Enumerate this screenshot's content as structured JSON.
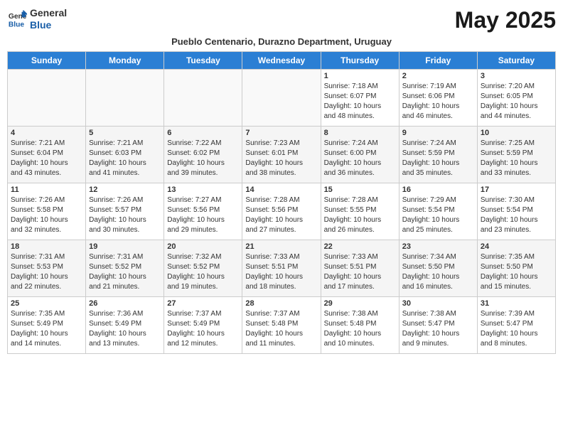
{
  "header": {
    "logo_general": "General",
    "logo_blue": "Blue",
    "month_title": "May 2025",
    "subtitle": "Pueblo Centenario, Durazno Department, Uruguay"
  },
  "days_of_week": [
    "Sunday",
    "Monday",
    "Tuesday",
    "Wednesday",
    "Thursday",
    "Friday",
    "Saturday"
  ],
  "weeks": [
    [
      {
        "day": "",
        "info": ""
      },
      {
        "day": "",
        "info": ""
      },
      {
        "day": "",
        "info": ""
      },
      {
        "day": "",
        "info": ""
      },
      {
        "day": "1",
        "info": "Sunrise: 7:18 AM\nSunset: 6:07 PM\nDaylight: 10 hours\nand 48 minutes."
      },
      {
        "day": "2",
        "info": "Sunrise: 7:19 AM\nSunset: 6:06 PM\nDaylight: 10 hours\nand 46 minutes."
      },
      {
        "day": "3",
        "info": "Sunrise: 7:20 AM\nSunset: 6:05 PM\nDaylight: 10 hours\nand 44 minutes."
      }
    ],
    [
      {
        "day": "4",
        "info": "Sunrise: 7:21 AM\nSunset: 6:04 PM\nDaylight: 10 hours\nand 43 minutes."
      },
      {
        "day": "5",
        "info": "Sunrise: 7:21 AM\nSunset: 6:03 PM\nDaylight: 10 hours\nand 41 minutes."
      },
      {
        "day": "6",
        "info": "Sunrise: 7:22 AM\nSunset: 6:02 PM\nDaylight: 10 hours\nand 39 minutes."
      },
      {
        "day": "7",
        "info": "Sunrise: 7:23 AM\nSunset: 6:01 PM\nDaylight: 10 hours\nand 38 minutes."
      },
      {
        "day": "8",
        "info": "Sunrise: 7:24 AM\nSunset: 6:00 PM\nDaylight: 10 hours\nand 36 minutes."
      },
      {
        "day": "9",
        "info": "Sunrise: 7:24 AM\nSunset: 5:59 PM\nDaylight: 10 hours\nand 35 minutes."
      },
      {
        "day": "10",
        "info": "Sunrise: 7:25 AM\nSunset: 5:59 PM\nDaylight: 10 hours\nand 33 minutes."
      }
    ],
    [
      {
        "day": "11",
        "info": "Sunrise: 7:26 AM\nSunset: 5:58 PM\nDaylight: 10 hours\nand 32 minutes."
      },
      {
        "day": "12",
        "info": "Sunrise: 7:26 AM\nSunset: 5:57 PM\nDaylight: 10 hours\nand 30 minutes."
      },
      {
        "day": "13",
        "info": "Sunrise: 7:27 AM\nSunset: 5:56 PM\nDaylight: 10 hours\nand 29 minutes."
      },
      {
        "day": "14",
        "info": "Sunrise: 7:28 AM\nSunset: 5:56 PM\nDaylight: 10 hours\nand 27 minutes."
      },
      {
        "day": "15",
        "info": "Sunrise: 7:28 AM\nSunset: 5:55 PM\nDaylight: 10 hours\nand 26 minutes."
      },
      {
        "day": "16",
        "info": "Sunrise: 7:29 AM\nSunset: 5:54 PM\nDaylight: 10 hours\nand 25 minutes."
      },
      {
        "day": "17",
        "info": "Sunrise: 7:30 AM\nSunset: 5:54 PM\nDaylight: 10 hours\nand 23 minutes."
      }
    ],
    [
      {
        "day": "18",
        "info": "Sunrise: 7:31 AM\nSunset: 5:53 PM\nDaylight: 10 hours\nand 22 minutes."
      },
      {
        "day": "19",
        "info": "Sunrise: 7:31 AM\nSunset: 5:52 PM\nDaylight: 10 hours\nand 21 minutes."
      },
      {
        "day": "20",
        "info": "Sunrise: 7:32 AM\nSunset: 5:52 PM\nDaylight: 10 hours\nand 19 minutes."
      },
      {
        "day": "21",
        "info": "Sunrise: 7:33 AM\nSunset: 5:51 PM\nDaylight: 10 hours\nand 18 minutes."
      },
      {
        "day": "22",
        "info": "Sunrise: 7:33 AM\nSunset: 5:51 PM\nDaylight: 10 hours\nand 17 minutes."
      },
      {
        "day": "23",
        "info": "Sunrise: 7:34 AM\nSunset: 5:50 PM\nDaylight: 10 hours\nand 16 minutes."
      },
      {
        "day": "24",
        "info": "Sunrise: 7:35 AM\nSunset: 5:50 PM\nDaylight: 10 hours\nand 15 minutes."
      }
    ],
    [
      {
        "day": "25",
        "info": "Sunrise: 7:35 AM\nSunset: 5:49 PM\nDaylight: 10 hours\nand 14 minutes."
      },
      {
        "day": "26",
        "info": "Sunrise: 7:36 AM\nSunset: 5:49 PM\nDaylight: 10 hours\nand 13 minutes."
      },
      {
        "day": "27",
        "info": "Sunrise: 7:37 AM\nSunset: 5:49 PM\nDaylight: 10 hours\nand 12 minutes."
      },
      {
        "day": "28",
        "info": "Sunrise: 7:37 AM\nSunset: 5:48 PM\nDaylight: 10 hours\nand 11 minutes."
      },
      {
        "day": "29",
        "info": "Sunrise: 7:38 AM\nSunset: 5:48 PM\nDaylight: 10 hours\nand 10 minutes."
      },
      {
        "day": "30",
        "info": "Sunrise: 7:38 AM\nSunset: 5:47 PM\nDaylight: 10 hours\nand 9 minutes."
      },
      {
        "day": "31",
        "info": "Sunrise: 7:39 AM\nSunset: 5:47 PM\nDaylight: 10 hours\nand 8 minutes."
      }
    ]
  ]
}
